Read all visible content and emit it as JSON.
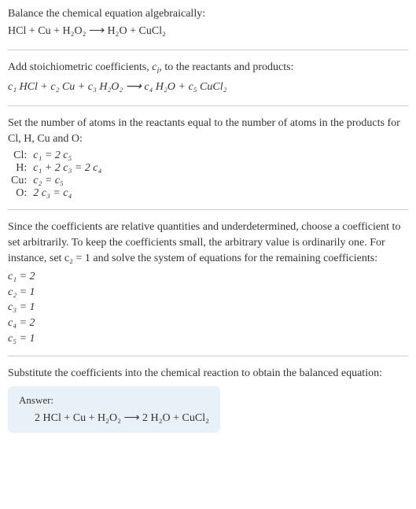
{
  "section1": {
    "line1": "Balance the chemical equation algebraically:",
    "eq": "HCl + Cu + H₂O₂  ⟶  H₂O + CuCl₂"
  },
  "section2": {
    "line1_a": "Add stoichiometric coefficients, ",
    "line1_b": "c",
    "line1_c": "i",
    "line1_d": ", to the reactants and products:",
    "eq": "c₁ HCl + c₂ Cu + c₃ H₂O₂  ⟶  c₄ H₂O + c₅ CuCl₂"
  },
  "section3": {
    "line1": "Set the number of atoms in the reactants equal to the number of atoms in the products for Cl, H, Cu and O:",
    "rows": [
      {
        "label": "Cl:",
        "value": "c₁ = 2 c₅"
      },
      {
        "label": "H:",
        "value": "c₁ + 2 c₃ = 2 c₄"
      },
      {
        "label": "Cu:",
        "value": "c₂ = c₅"
      },
      {
        "label": "O:",
        "value": "2 c₃ = c₄"
      }
    ]
  },
  "section4": {
    "line1": "Since the coefficients are relative quantities and underdetermined, choose a coefficient to set arbitrarily. To keep the coefficients small, the arbitrary value is ordinarily one. For instance, set c₂ = 1 and solve the system of equations for the remaining coefficients:",
    "coeffs": [
      "c₁ = 2",
      "c₂ = 1",
      "c₃ = 1",
      "c₄ = 2",
      "c₅ = 1"
    ]
  },
  "section5": {
    "line1": "Substitute the coefficients into the chemical reaction to obtain the balanced equation:",
    "answer_label": "Answer:",
    "answer_eq": "2 HCl + Cu + H₂O₂  ⟶  2 H₂O + CuCl₂"
  }
}
